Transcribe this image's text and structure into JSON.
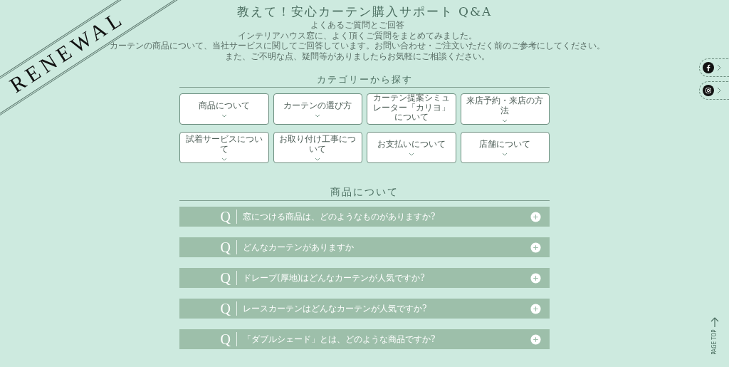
{
  "banner": {
    "text": "RENEWAL"
  },
  "page_title": "教えて！安心カーテン購入サポート Q&A",
  "intro": [
    "よくあるご質問とご回答",
    "インテリアハウス窓に、よく頂くご質問をまとめてみました。",
    "カーテンの商品について、当社サービスに関してご回答しています。お問い合わせ・ご注文いただく前のご参考にしてください。",
    "また、ご不明な点、疑問等がありましたらお気軽にご相談ください。"
  ],
  "category_heading": "カテゴリーから探す",
  "categories": [
    "商品について",
    "カーテンの選び方",
    "カーテン提案シミュレーター「カリヨ」について",
    "来店予約・来店の方法",
    "試着サービスについて",
    "お取り付け工事について",
    "お支払いについて",
    "店舗について"
  ],
  "section": {
    "heading": "商品について",
    "faqs": [
      {
        "mark": "Q",
        "question": "窓につける商品は、どのようなものがありますか?",
        "expanded": false
      },
      {
        "mark": "Q",
        "question": "どんなカーテンがありますか",
        "expanded": false
      },
      {
        "mark": "Q",
        "question": "ドレープ(厚地)はどんなカーテンが人気ですか?",
        "expanded": false
      },
      {
        "mark": "Q",
        "question": "レースカーテンはどんなカーテンが人気ですか?",
        "expanded": false
      },
      {
        "mark": "Q",
        "question": "「ダブルシェード」とは、どのような商品ですか?",
        "expanded": false
      }
    ]
  },
  "social": [
    {
      "kind": "facebook"
    },
    {
      "kind": "instagram"
    }
  ],
  "page_top": {
    "label": "PAGE TOP"
  }
}
